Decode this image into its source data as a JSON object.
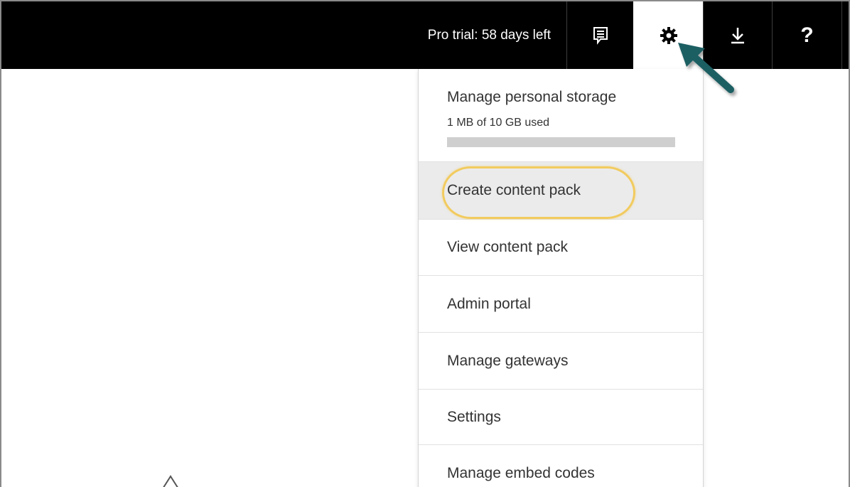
{
  "topbar": {
    "trial_text": "Pro trial: 58 days left",
    "buttons": [
      {
        "name": "feedback",
        "icon": "feedback-icon"
      },
      {
        "name": "settings",
        "icon": "gear-icon",
        "active": true
      },
      {
        "name": "download",
        "icon": "download-icon"
      },
      {
        "name": "help",
        "icon": "help-icon",
        "label": "?"
      }
    ]
  },
  "menu": {
    "storage": {
      "title": "Manage personal storage",
      "usage": "1 MB of 10 GB used",
      "used_fraction": 0.0001
    },
    "items": [
      {
        "label": "Create content pack",
        "highlighted": true
      },
      {
        "label": "View content pack"
      },
      {
        "label": "Admin portal"
      },
      {
        "label": "Manage gateways"
      },
      {
        "label": "Settings"
      },
      {
        "label": "Manage embed codes"
      }
    ]
  },
  "colors": {
    "topbar_bg": "#000000",
    "highlight_ring": "#f2cb5f",
    "pointer_arrow": "#1f5f63",
    "hover_bg": "#ebebeb"
  }
}
